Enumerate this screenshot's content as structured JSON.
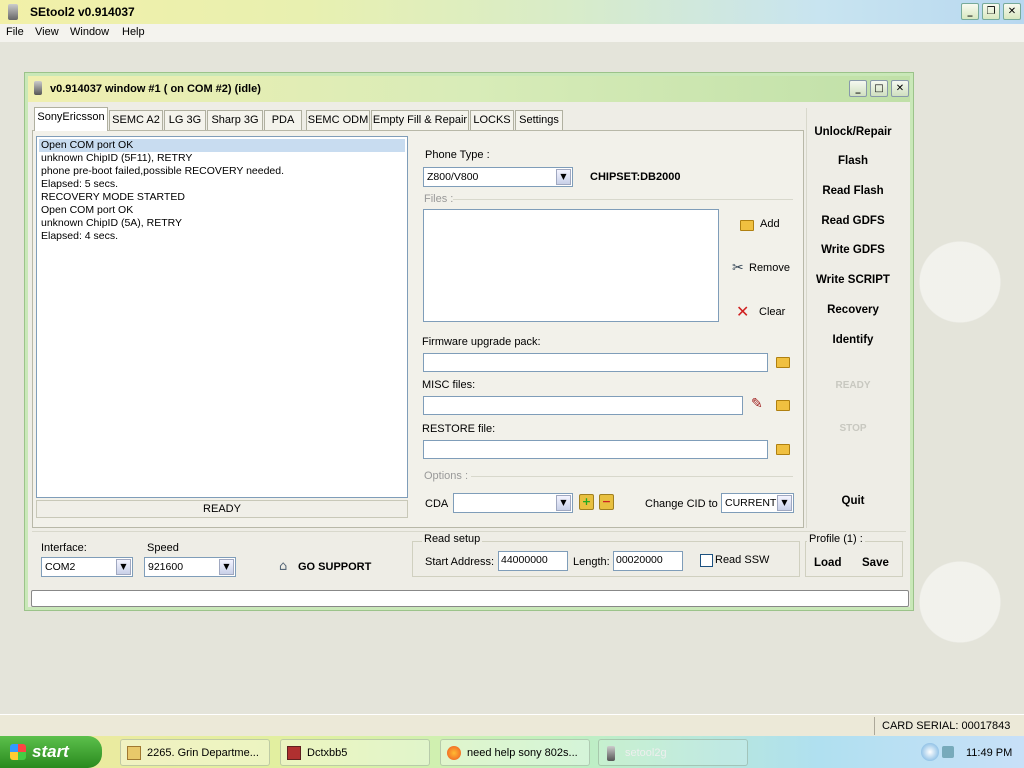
{
  "app": {
    "title": "SEtool2 v0.914037"
  },
  "menu": [
    "File",
    "View",
    "Window",
    "Help"
  ],
  "child_window": {
    "title": "v0.914037 window #1 ( on COM #2) (idle)"
  },
  "tabs": [
    "SonyEricsson",
    "SEMC A2",
    "LG 3G",
    "Sharp 3G",
    "PDA",
    "SEMC ODM",
    "Empty Fill & Repair",
    "LOCKS",
    "Settings"
  ],
  "log": {
    "lines": [
      "Open COM port OK",
      "unknown ChipID (5F11), RETRY",
      "phone pre-boot failed,possible RECOVERY needed.",
      "Elapsed: 5 secs.",
      "RECOVERY MODE STARTED",
      "Open COM port OK",
      "unknown ChipID (5A), RETRY",
      "Elapsed: 4 secs."
    ],
    "status": "READY"
  },
  "phone": {
    "phone_type_label": "Phone Type :",
    "phone_type_value": "Z800/V800",
    "chipset": "CHIPSET:DB2000",
    "files_label": "Files :",
    "add": "Add",
    "remove": "Remove",
    "clear": "Clear",
    "firmware_label": "Firmware upgrade pack:",
    "misc_label": "MISC files:",
    "restore_label": "RESTORE file:",
    "options_label": "Options :",
    "cda_label": "CDA",
    "change_cid_label": "Change CID to",
    "change_cid_value": "CURRENT"
  },
  "actions": {
    "unlock": "Unlock/Repair",
    "flash": "Flash",
    "read_flash": "Read Flash",
    "read_gdfs": "Read GDFS",
    "write_gdfs": "Write GDFS",
    "write_script": "Write SCRIPT",
    "recovery": "Recovery",
    "identify": "Identify",
    "ready": "READY",
    "stop": "STOP",
    "quit": "Quit"
  },
  "connection": {
    "interface_label": "Interface:",
    "interface_value": "COM2",
    "speed_label": "Speed",
    "speed_value": "921600",
    "go_support": "GO SUPPORT"
  },
  "read_setup": {
    "title": "Read setup",
    "start_label": "Start Address:",
    "start_value": "44000000",
    "length_label": "Length:",
    "length_value": "00020000",
    "ssw_label": "Read SSW"
  },
  "profile": {
    "title": "Profile (1) :",
    "load": "Load",
    "save": "Save"
  },
  "statusbar": {
    "card_serial": "CARD SERIAL: 00017843"
  },
  "taskbar": {
    "start": "start",
    "tasks": [
      "2265. Grin Departme...",
      "Dctxbb5",
      "need help sony 802s...",
      "setool2g"
    ],
    "clock": "11:49 PM"
  }
}
